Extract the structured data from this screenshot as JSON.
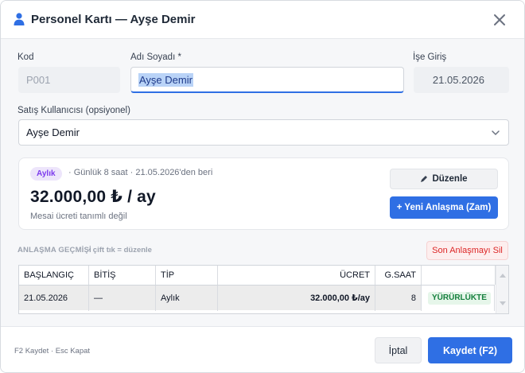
{
  "dialog": {
    "title": "Personel Kartı — Ayşe Demir",
    "person_icon": "person-icon",
    "close_icon": "close-icon"
  },
  "form": {
    "kod_label": "Kod",
    "kod_placeholder": "P001",
    "adsoyad_label": "Adı Soyadı *",
    "adsoyad_value": "Ayşe Demir",
    "isegiris_label": "İşe Giriş",
    "isegiris_value": "21.05.2026",
    "satis_label": "Satış Kullanıcısı (opsiyonel)",
    "satis_value": "Ayşe Demir",
    "chevron_icon": "chevron-down-icon"
  },
  "agreement": {
    "badge": "Aylık",
    "meta": "· Günlük 8 saat · 21.05.2026'den beri",
    "amount": "32.000,00 ₺ / ay",
    "overtime_note": "Mesai ücreti tanımlı değil",
    "edit_label": "Düzenle",
    "edit_icon": "pencil-icon",
    "new_label": "+ Yeni Anlaşma (Zam)"
  },
  "history": {
    "title": "ANLAŞMA GEÇMİŞİ",
    "hint": "· çift tık = düzenle",
    "delete_last_label": "Son Anlaşmayı Sil",
    "columns": [
      "BAŞLANGIÇ",
      "BİTİŞ",
      "TİP",
      "ÜCRET",
      "G.SAAT",
      ""
    ],
    "rows": [
      {
        "start": "21.05.2026",
        "end": "—",
        "type": "Aylık",
        "wage": "32.000,00 ₺/ay",
        "hours": "8",
        "status": "YÜRÜRLÜKTE"
      }
    ]
  },
  "footer": {
    "hint": "F2 Kaydet · Esc Kapat",
    "cancel_label": "İptal",
    "save_label": "Kaydet (F2)"
  },
  "colors": {
    "accent": "#2f6fe4",
    "badge_purple": "#7c3aed",
    "status_green": "#15803d",
    "danger": "#dc2626"
  }
}
